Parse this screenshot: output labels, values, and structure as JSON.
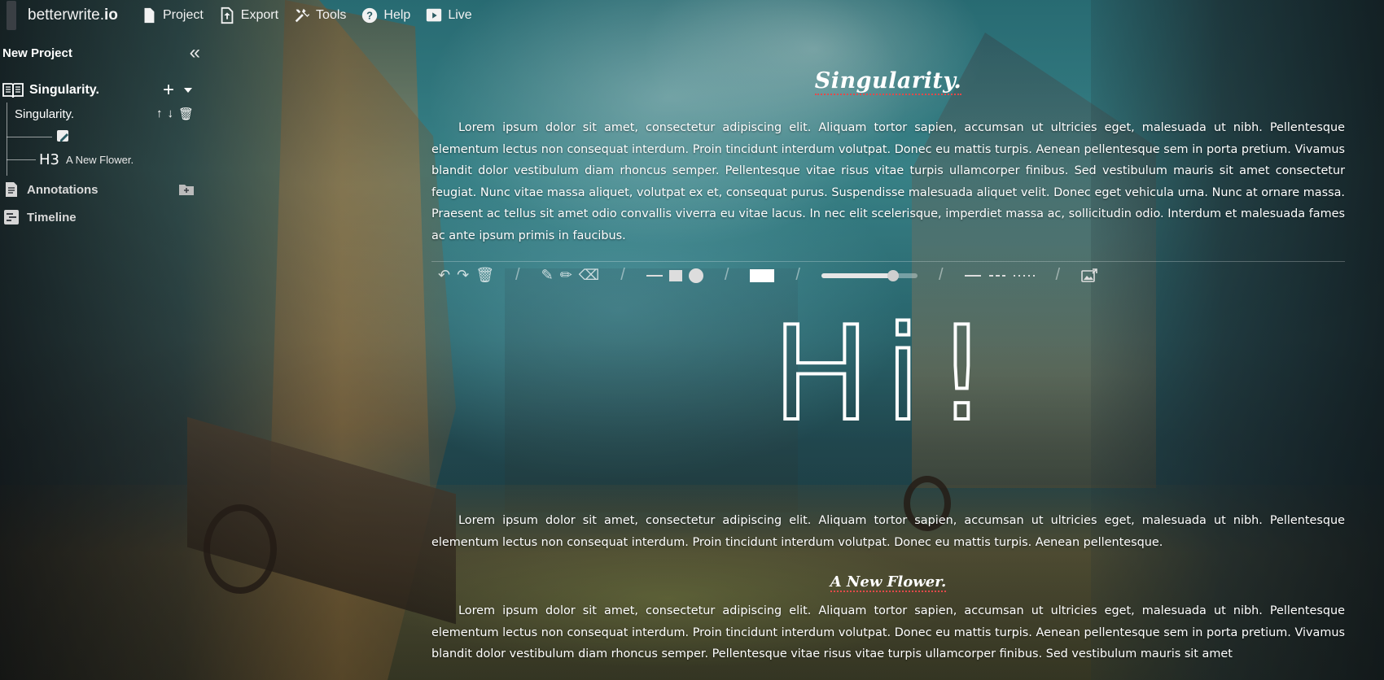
{
  "app": {
    "brand_light": "betterwrite.",
    "brand_bold": "io"
  },
  "menu": [
    {
      "label": "Project",
      "icon": "file-icon"
    },
    {
      "label": "Export",
      "icon": "file-export-icon"
    },
    {
      "label": "Tools",
      "icon": "tools-icon"
    },
    {
      "label": "Help",
      "icon": "help-circle-icon"
    },
    {
      "label": "Live",
      "icon": "live-icon"
    }
  ],
  "sidebar": {
    "project_title": "New Project",
    "collapse_symbol": "«",
    "chapter": {
      "label": "Singularity.",
      "add_symbol": "+",
      "page": {
        "label": "Singularity.",
        "ops": [
          "↑",
          "↓",
          "🗑"
        ]
      },
      "drawing_icon": "pen-drawing-icon",
      "heading": {
        "tag": "H3",
        "label": "A New Flower."
      }
    },
    "sections": [
      {
        "label": "Annotations",
        "icon": "document-icon",
        "action_icon": "folder-plus-icon"
      },
      {
        "label": "Timeline",
        "icon": "timeline-icon"
      }
    ]
  },
  "editor": {
    "chapter_title": "Singularity.",
    "paragraph_1": "Lorem ipsum dolor sit amet, consectetur adipiscing elit. Aliquam tortor sapien, accumsan ut ultricies eget, malesuada ut nibh. Pellentesque elementum lectus non consequat interdum. Proin tincidunt interdum volutpat. Donec eu mattis turpis. Aenean pellentesque sem in porta pretium. Vivamus blandit dolor vestibulum diam rhoncus semper. Pellentesque vitae risus vitae turpis ullamcorper finibus. Sed vestibulum mauris sit amet consectetur feugiat. Nunc vitae massa aliquet, volutpat ex et, consequat purus. Suspendisse malesuada aliquet velit. Donec eget vehicula urna. Nunc at ornare massa. Praesent ac tellus sit amet odio convallis viverra eu vitae lacus. In nec elit scelerisque, imperdiet massa ac, sollicitudin odio. Interdum et malesuada fames ac ante ipsum primis in faucibus.",
    "toolbar": {
      "undo": "↶",
      "redo": "↷",
      "trash": "🗑",
      "edit": "✎",
      "pen": "✏",
      "eraser": "⌫",
      "divider": "/",
      "stroke_width_fraction": 0.75
    },
    "drawing_text": "Hi!",
    "paragraph_2": "Lorem ipsum dolor sit amet, consectetur adipiscing elit. Aliquam tortor sapien, accumsan ut ultricies eget, malesuada ut nibh. Pellentesque elementum lectus non consequat interdum. Proin tincidunt interdum volutpat. Donec eu mattis turpis. Aenean pellentesque.",
    "subheading": "A New Flower.",
    "paragraph_3": "Lorem ipsum dolor sit amet, consectetur adipiscing elit. Aliquam tortor sapien, accumsan ut ultricies eget, malesuada ut nibh. Pellentesque elementum lectus non consequat interdum. Proin tincidunt interdum volutpat. Donec eu mattis turpis. Aenean pellentesque sem in porta pretium. Vivamus blandit dolor vestibulum diam rhoncus semper. Pellentesque vitae risus vitae turpis ullamcorper finibus. Sed vestibulum mauris sit amet"
  },
  "colors": {
    "spellcheck_underline": "#d13a3a",
    "text": "#ffffff",
    "sky_teal": "#2f7d86"
  }
}
